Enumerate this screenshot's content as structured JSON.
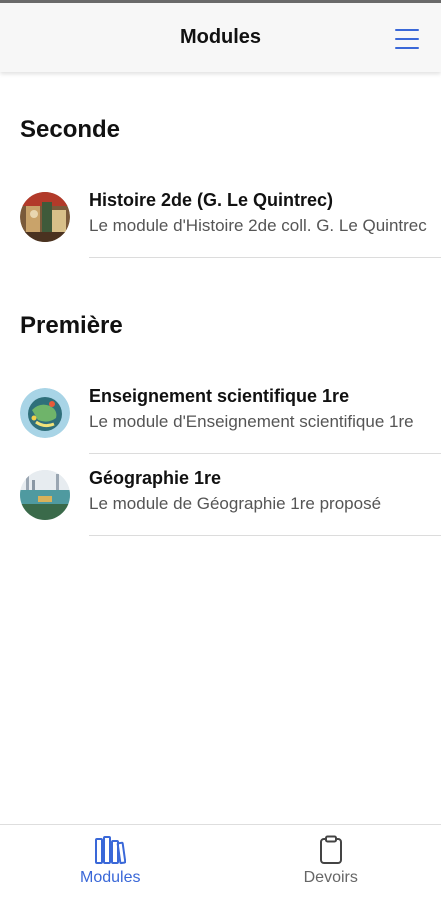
{
  "header": {
    "title": "Modules",
    "menu_icon": "hamburger-menu-icon"
  },
  "sections": [
    {
      "title": "Seconde",
      "items": [
        {
          "name": "Histoire 2de (G. Le Quintrec)",
          "description": "Le module d'Histoire 2de coll. G. Le Quintrec"
        }
      ]
    },
    {
      "title": "Première",
      "items": [
        {
          "name": "Enseignement scientifique 1re",
          "description": "Le module d'Enseignement scientifique 1re"
        },
        {
          "name": "Géographie 1re",
          "description": "Le module de Géographie 1re proposé"
        }
      ]
    }
  ],
  "bottom_nav": {
    "tabs": [
      {
        "label": "Modules",
        "icon": "books-icon",
        "active": true
      },
      {
        "label": "Devoirs",
        "icon": "clipboard-icon",
        "active": false
      }
    ]
  },
  "colors": {
    "accent": "#3a68d8",
    "text": "#111111",
    "muted": "#555555"
  }
}
